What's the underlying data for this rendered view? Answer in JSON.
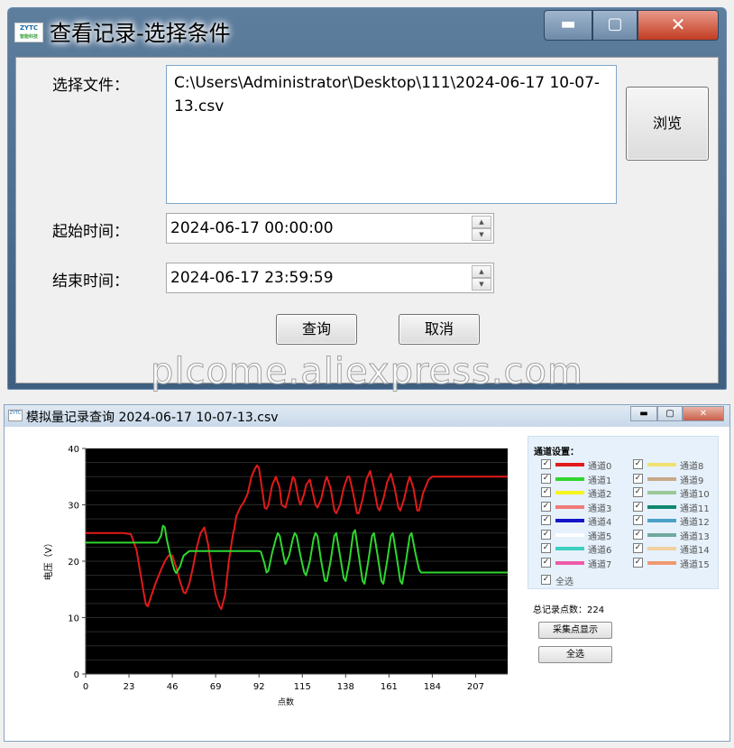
{
  "dialog": {
    "logo_text": "ZYTC",
    "logo_sub": "智能科技",
    "title": "查看记录-选择条件",
    "file_label": "选择文件：",
    "file_path": "C:\\Users\\Administrator\\Desktop\\111\\2024-06-17 10-07-13.csv",
    "browse_label": "浏览",
    "start_label": "起始时间：",
    "start_value": "2024-06-17 00:00:00",
    "end_label": "结束时间：",
    "end_value": "2024-06-17 23:59:59",
    "query_label": "查询",
    "cancel_label": "取消"
  },
  "watermark": "plcome.aliexpress.com",
  "window": {
    "icon_text": "ZYTC",
    "title": "模拟量记录查询  2024-06-17 10-07-13.csv",
    "channel_settings_label": "通道设置：",
    "channels": [
      {
        "name": "通道0",
        "color": "#e21a1a",
        "checked": true
      },
      {
        "name": "通道1",
        "color": "#2fd62f",
        "checked": true
      },
      {
        "name": "通道2",
        "color": "#f5f51e",
        "checked": true
      },
      {
        "name": "通道3",
        "color": "#f07a7a",
        "checked": true
      },
      {
        "name": "通道4",
        "color": "#1414c8",
        "checked": true
      },
      {
        "name": "通道5",
        "color": "#ffffff",
        "checked": true
      },
      {
        "name": "通道6",
        "color": "#3ccfc0",
        "checked": true
      },
      {
        "name": "通道7",
        "color": "#f05aa8",
        "checked": true
      },
      {
        "name": "通道8",
        "color": "#f0e070",
        "checked": true
      },
      {
        "name": "通道9",
        "color": "#c8a888",
        "checked": true
      },
      {
        "name": "通道10",
        "color": "#9cc898",
        "checked": true
      },
      {
        "name": "通道11",
        "color": "#108870",
        "checked": true
      },
      {
        "name": "通道12",
        "color": "#4aa0c8",
        "checked": true
      },
      {
        "name": "通道13",
        "color": "#70a8a0",
        "checked": true
      },
      {
        "name": "通道14",
        "color": "#f0d0a0",
        "checked": true
      },
      {
        "name": "通道15",
        "color": "#f09870",
        "checked": true
      }
    ],
    "select_all_label": "全选",
    "total_label": "总记录点数：224",
    "show_points_button": "采集点显示",
    "select_all_button": "全选"
  },
  "chart_data": {
    "type": "line",
    "xlabel": "点数",
    "ylabel": "电压（V）",
    "xlim": [
      0,
      224
    ],
    "ylim": [
      0,
      40
    ],
    "x_ticks": [
      0,
      23,
      46,
      69,
      92,
      115,
      138,
      161,
      184,
      207
    ],
    "y_ticks": [
      0,
      10,
      20,
      30,
      40
    ],
    "background": "#000000",
    "grid": true,
    "series": [
      {
        "name": "通道0",
        "color": "#e21a1a",
        "points": [
          [
            0,
            25
          ],
          [
            20,
            25
          ],
          [
            24,
            24.8
          ],
          [
            27,
            22
          ],
          [
            29,
            18
          ],
          [
            31,
            14
          ],
          [
            32,
            12.3
          ],
          [
            33,
            12
          ],
          [
            35,
            14
          ],
          [
            37,
            16
          ],
          [
            40,
            18.5
          ],
          [
            42,
            20
          ],
          [
            44,
            21
          ],
          [
            46,
            21
          ],
          [
            48,
            19
          ],
          [
            50,
            16.5
          ],
          [
            52,
            14.5
          ],
          [
            53,
            14.3
          ],
          [
            55,
            16
          ],
          [
            57,
            19
          ],
          [
            59,
            22.5
          ],
          [
            61,
            25
          ],
          [
            63,
            26
          ],
          [
            65,
            23
          ],
          [
            67,
            18
          ],
          [
            69,
            14
          ],
          [
            71,
            12
          ],
          [
            72,
            11.5
          ],
          [
            74,
            14
          ],
          [
            76,
            20
          ],
          [
            78,
            24.5
          ],
          [
            79,
            26
          ],
          [
            80,
            28
          ],
          [
            82,
            29.5
          ],
          [
            84,
            30.5
          ],
          [
            86,
            32
          ],
          [
            87,
            33.5
          ],
          [
            88,
            35
          ],
          [
            90,
            36.5
          ],
          [
            91,
            37
          ],
          [
            92,
            36.5
          ],
          [
            94,
            32
          ],
          [
            95,
            29.5
          ],
          [
            96,
            29.3
          ],
          [
            97,
            30
          ],
          [
            99,
            33.5
          ],
          [
            101,
            35
          ],
          [
            103,
            33
          ],
          [
            104,
            30
          ],
          [
            106,
            29.5
          ],
          [
            108,
            32
          ],
          [
            110,
            35
          ],
          [
            111,
            34.5
          ],
          [
            113,
            31
          ],
          [
            114,
            30
          ],
          [
            116,
            32
          ],
          [
            117,
            33.5
          ],
          [
            119,
            34.5
          ],
          [
            120,
            33
          ],
          [
            122,
            30
          ],
          [
            123,
            29.5
          ],
          [
            125,
            31
          ],
          [
            127,
            34
          ],
          [
            128,
            35
          ],
          [
            130,
            33
          ],
          [
            132,
            29
          ],
          [
            133,
            28.5
          ],
          [
            135,
            30
          ],
          [
            137,
            33
          ],
          [
            139,
            35
          ],
          [
            140,
            35
          ],
          [
            142,
            32
          ],
          [
            144,
            28.5
          ],
          [
            145,
            28.5
          ],
          [
            147,
            31
          ],
          [
            149,
            34.5
          ],
          [
            151,
            36
          ],
          [
            153,
            33
          ],
          [
            155,
            29.5
          ],
          [
            156,
            29
          ],
          [
            158,
            31
          ],
          [
            160,
            34
          ],
          [
            162,
            35.5
          ],
          [
            164,
            33
          ],
          [
            166,
            29.5
          ],
          [
            167,
            29
          ],
          [
            169,
            31
          ],
          [
            171,
            34
          ],
          [
            172,
            35
          ],
          [
            174,
            33
          ],
          [
            176,
            29
          ],
          [
            177,
            29
          ],
          [
            179,
            32
          ],
          [
            182,
            34.5
          ],
          [
            184,
            35
          ],
          [
            224,
            35
          ]
        ]
      },
      {
        "name": "通道1",
        "color": "#2fd62f",
        "points": [
          [
            0,
            23.3
          ],
          [
            27,
            23.3
          ],
          [
            38,
            23.3
          ],
          [
            40,
            24.5
          ],
          [
            41,
            26.3
          ],
          [
            42,
            26
          ],
          [
            43,
            24
          ],
          [
            45,
            21
          ],
          [
            47,
            18.5
          ],
          [
            48,
            17.9
          ],
          [
            50,
            19
          ],
          [
            52,
            21
          ],
          [
            55,
            21.8
          ],
          [
            92,
            21.8
          ],
          [
            93,
            21.7
          ],
          [
            95,
            19.5
          ],
          [
            96,
            18
          ],
          [
            97,
            18.3
          ],
          [
            99,
            21.5
          ],
          [
            101,
            24
          ],
          [
            102,
            25
          ],
          [
            103,
            24.5
          ],
          [
            105,
            21
          ],
          [
            106,
            19.5
          ],
          [
            108,
            21
          ],
          [
            110,
            24
          ],
          [
            111,
            25
          ],
          [
            112,
            24.5
          ],
          [
            114,
            21
          ],
          [
            116,
            18
          ],
          [
            117,
            17.5
          ],
          [
            119,
            20
          ],
          [
            121,
            24
          ],
          [
            122,
            25
          ],
          [
            123,
            24.5
          ],
          [
            125,
            20
          ],
          [
            127,
            16.5
          ],
          [
            128,
            16.5
          ],
          [
            130,
            20
          ],
          [
            132,
            24.5
          ],
          [
            133,
            25
          ],
          [
            135,
            21
          ],
          [
            137,
            17
          ],
          [
            138,
            16.5
          ],
          [
            140,
            20
          ],
          [
            142,
            25
          ],
          [
            143,
            25.5
          ],
          [
            145,
            21
          ],
          [
            147,
            16.5
          ],
          [
            148,
            16
          ],
          [
            150,
            20
          ],
          [
            152,
            24.5
          ],
          [
            153,
            25
          ],
          [
            155,
            21
          ],
          [
            157,
            16.5
          ],
          [
            158,
            16
          ],
          [
            160,
            20
          ],
          [
            162,
            24.5
          ],
          [
            163,
            25
          ],
          [
            165,
            21
          ],
          [
            167,
            16.5
          ],
          [
            168,
            16
          ],
          [
            170,
            20
          ],
          [
            172,
            24.5
          ],
          [
            173,
            25
          ],
          [
            175,
            21.5
          ],
          [
            177,
            18.5
          ],
          [
            178,
            18
          ],
          [
            224,
            18
          ]
        ]
      }
    ]
  }
}
